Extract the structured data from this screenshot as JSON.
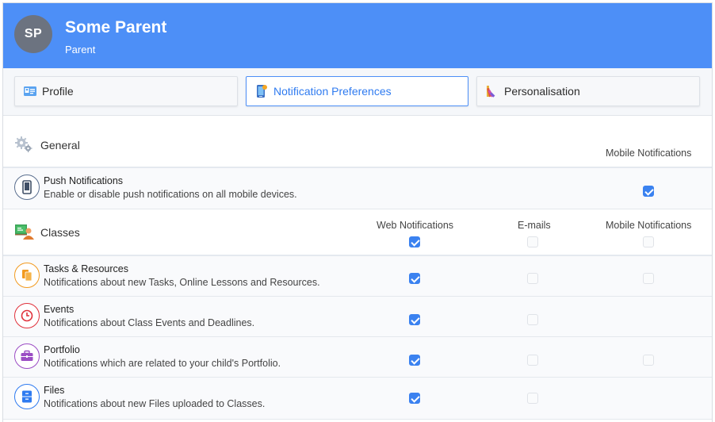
{
  "user": {
    "initials": "SP",
    "name": "Some Parent",
    "role": "Parent"
  },
  "tabs": [
    {
      "label": "Profile",
      "icon": "id-card-icon",
      "active": false
    },
    {
      "label": "Notification Preferences",
      "icon": "phone-notification-icon",
      "active": true
    },
    {
      "label": "Personalisation",
      "icon": "palette-icon",
      "active": false
    }
  ],
  "general": {
    "title": "General",
    "icon": "gears-icon",
    "columns": {
      "mobile": "Mobile Notifications"
    },
    "rows": [
      {
        "title": "Push Notifications",
        "description": "Enable or disable push notifications on all mobile devices.",
        "icon": "mobile-phone-icon",
        "mobile": true
      }
    ]
  },
  "classes": {
    "title": "Classes",
    "icon": "classroom-teacher-icon",
    "columns": {
      "web": "Web Notifications",
      "email": "E-mails",
      "mobile": "Mobile Notifications"
    },
    "header_toggles": {
      "web": true,
      "email": false,
      "mobile": false
    },
    "rows": [
      {
        "title": "Tasks & Resources",
        "description": "Notifications about new Tasks, Online Lessons and Resources.",
        "icon": "documents-icon",
        "color": "#f29a1f",
        "web": true,
        "email": false,
        "mobile": false
      },
      {
        "title": "Events",
        "description": "Notifications about Class Events and Deadlines.",
        "icon": "clock-icon",
        "color": "#e0313b",
        "web": true,
        "email": false
      },
      {
        "title": "Portfolio",
        "description": "Notifications which are related to your child's Portfolio.",
        "icon": "briefcase-icon",
        "color": "#9b4cc4",
        "web": true,
        "email": false,
        "mobile": false
      },
      {
        "title": "Files",
        "description": "Notifications about new Files uploaded to Classes.",
        "icon": "file-cabinet-icon",
        "color": "#2f7bf0",
        "web": true,
        "email": false
      }
    ]
  },
  "colors": {
    "header": "#4d8ff7",
    "accent": "#3b82f0",
    "avatar": "#6c7380"
  }
}
